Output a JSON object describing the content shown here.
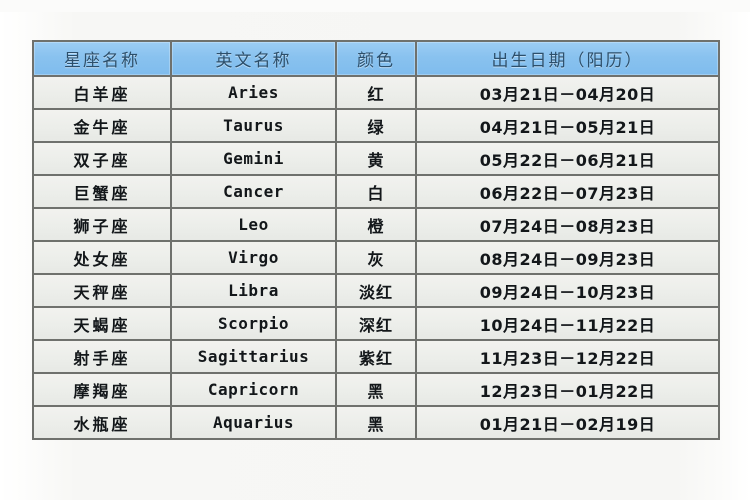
{
  "page": {
    "top_ghost_text": "···  ··  ····",
    "background_color": "#f7f7f5",
    "header_color": "#89c2ef",
    "cell_color": "#eceeea",
    "border_color": "#6f716d"
  },
  "table": {
    "headers": [
      "星座名称",
      "英文名称",
      "颜色",
      "出生日期（阳历）"
    ],
    "rows": [
      {
        "cn_name": "白羊座",
        "en_name": "Aries",
        "color": "红",
        "date": "03月21日－04月20日"
      },
      {
        "cn_name": "金牛座",
        "en_name": "Taurus",
        "color": "绿",
        "date": "04月21日－05月21日"
      },
      {
        "cn_name": "双子座",
        "en_name": "Gemini",
        "color": "黄",
        "date": "05月22日－06月21日"
      },
      {
        "cn_name": "巨蟹座",
        "en_name": "Cancer",
        "color": "白",
        "date": "06月22日－07月23日"
      },
      {
        "cn_name": "狮子座",
        "en_name": "Leo",
        "color": "橙",
        "date": "07月24日－08月23日"
      },
      {
        "cn_name": "处女座",
        "en_name": "Virgo",
        "color": "灰",
        "date": "08月24日－09月23日"
      },
      {
        "cn_name": "天秤座",
        "en_name": "Libra",
        "color": "淡红",
        "date": "09月24日－10月23日"
      },
      {
        "cn_name": "天蝎座",
        "en_name": "Scorpio",
        "color": "深红",
        "date": "10月24日－11月22日"
      },
      {
        "cn_name": "射手座",
        "en_name": "Sagittarius",
        "color": "紫红",
        "date": "11月23日－12月22日"
      },
      {
        "cn_name": "摩羯座",
        "en_name": "Capricorn",
        "color": "黑",
        "date": "12月23日－01月22日"
      },
      {
        "cn_name": "水瓶座",
        "en_name": "Aquarius",
        "color": "黑",
        "date": "01月21日－02月19日"
      }
    ]
  }
}
